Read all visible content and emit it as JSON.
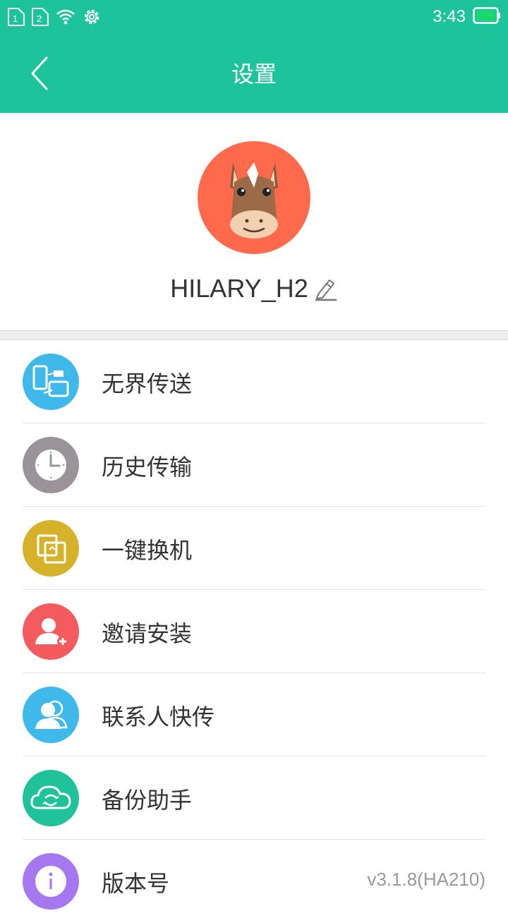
{
  "status_bar": {
    "time": "3:43",
    "sim1_label": "1",
    "sim2_label": "2",
    "icons": [
      "sim1-icon",
      "sim2-icon",
      "wifi-icon",
      "settings-gear-icon",
      "battery-icon"
    ]
  },
  "header": {
    "title": "设置",
    "back_icon": "back-arrow-icon"
  },
  "profile": {
    "device_name": "HILARY_H2",
    "avatar_icon": "horse-avatar",
    "edit_icon": "pencil-icon"
  },
  "menu": {
    "items": [
      {
        "label": "无界传送",
        "icon": "phone-transfer-icon",
        "color": "#3fb8ea"
      },
      {
        "label": "历史传输",
        "icon": "clock-icon",
        "color": "#9a9399"
      },
      {
        "label": "一键换机",
        "icon": "switch-phone-icon",
        "color": "#d6b22a"
      },
      {
        "label": "邀请安装",
        "icon": "add-user-icon",
        "color": "#f45b5e"
      },
      {
        "label": "联系人快传",
        "icon": "contacts-icon",
        "color": "#3fb8ea"
      },
      {
        "label": "备份助手",
        "icon": "cloud-sync-icon",
        "color": "#20c29a"
      },
      {
        "label": "版本号",
        "icon": "info-icon",
        "color": "#a678f0",
        "value": "v3.1.8(HA210)"
      }
    ]
  },
  "colors": {
    "primary": "#1dc39b",
    "avatar_bg": "#ff6a4d"
  }
}
